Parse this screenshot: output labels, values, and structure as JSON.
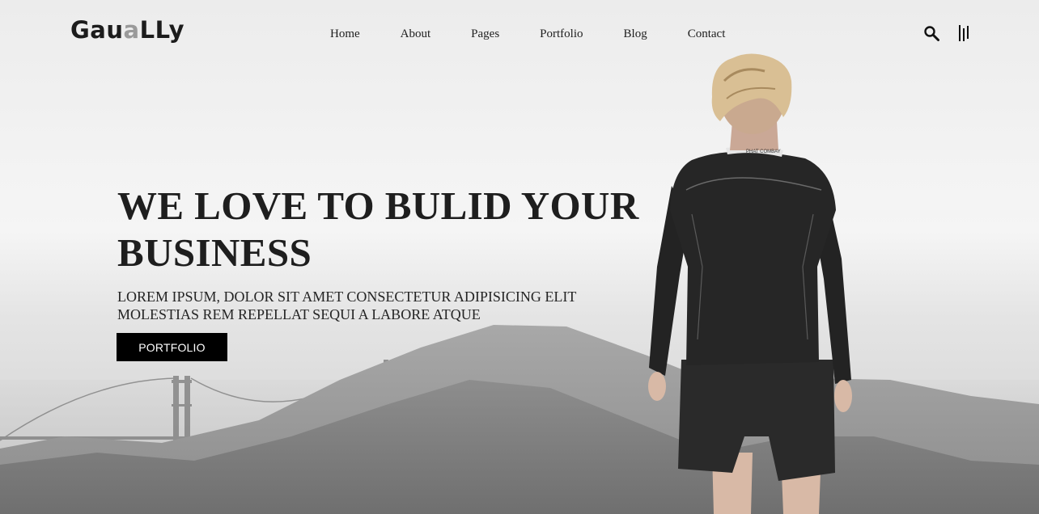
{
  "brand": {
    "logo_main": "Gau",
    "logo_accent": "a",
    "logo_tail": "LLy"
  },
  "nav": {
    "items": [
      "Home",
      "About",
      "Pages",
      "Portfolio",
      "Blog",
      "Contact"
    ]
  },
  "header": {
    "search_icon": "search-icon",
    "menu_icon": "hamburger-menu-icon"
  },
  "hero": {
    "headline": "WE LOVE TO BULID YOUR BUSINESS",
    "subtitle": "LOREM IPSUM, DOLOR SIT AMET CONSECTETUR ADIPISICING ELIT MOLESTIAS REM REPELLAT SEQUI A LABORE ATQUE",
    "cta_label": "PORTFOLIO",
    "shirt_collar_text": "PHAT COMBAY"
  },
  "colors": {
    "text": "#1e1e1e",
    "button_bg": "#000000",
    "button_text": "#ffffff",
    "logo_accent": "#9a9a9a"
  }
}
